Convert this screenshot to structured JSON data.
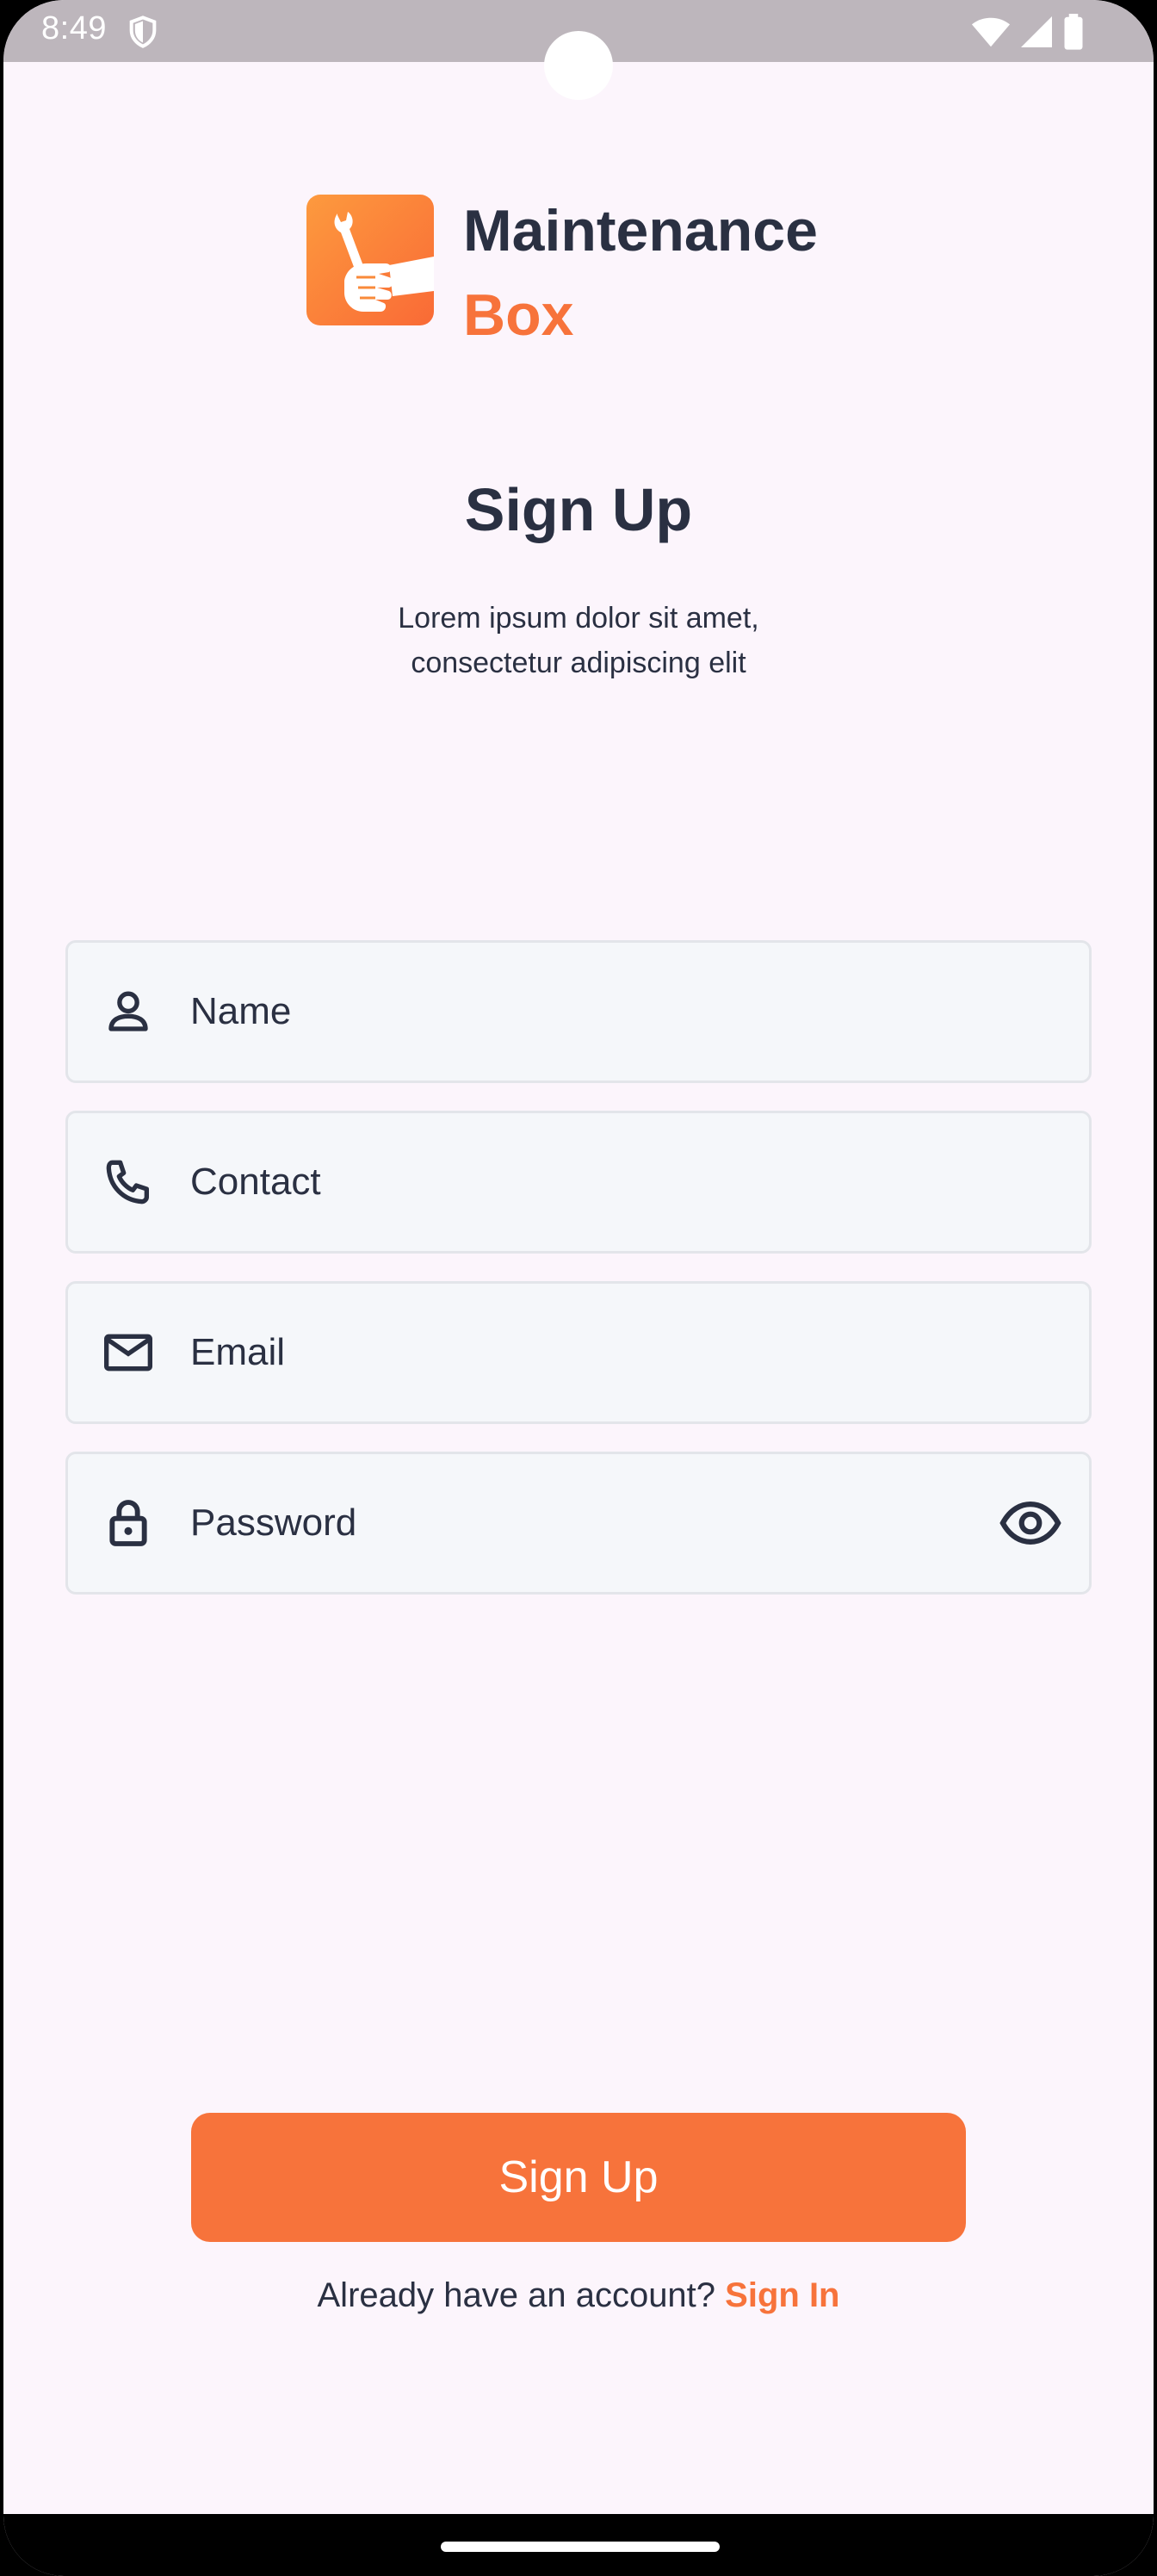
{
  "status_bar": {
    "time": "8:49"
  },
  "logo": {
    "line1": "Maintenance",
    "line2": "Box"
  },
  "header": {
    "title": "Sign Up",
    "subtitle": "Lorem ipsum dolor sit amet, consectetur adipiscing elit"
  },
  "form": {
    "name": {
      "placeholder": "Name",
      "value": ""
    },
    "contact": {
      "placeholder": "Contact",
      "value": ""
    },
    "email": {
      "placeholder": "Email",
      "value": ""
    },
    "password": {
      "placeholder": "Password",
      "value": ""
    }
  },
  "actions": {
    "sign_up_label": "Sign Up",
    "signin_prompt": "Already have an account?",
    "signin_link": "Sign In"
  },
  "colors": {
    "accent": "#f7733b",
    "text": "#2a3042",
    "background": "#fcf5fc",
    "field_bg": "#f5f7fa"
  },
  "icons": {
    "name_field": "person-icon",
    "contact_field": "phone-icon",
    "email_field": "mail-icon",
    "password_field": "lock-icon",
    "password_toggle": "eye-icon"
  }
}
